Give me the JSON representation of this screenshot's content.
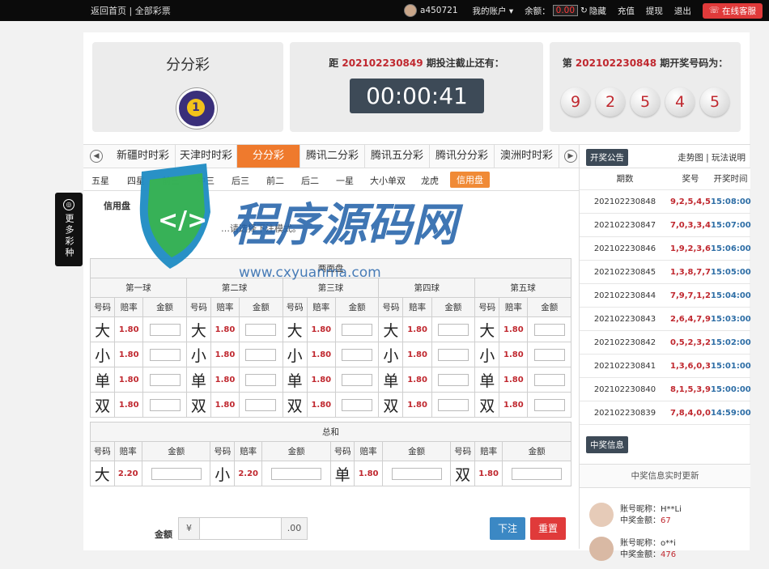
{
  "topbar": {
    "home_link": "返回首页",
    "all_lottery": "全部彩票",
    "username": "a450721",
    "my_account": "我的账户 ▾",
    "balance_label": "余额：",
    "balance_value": "0.00",
    "hide": "隐藏",
    "recharge": "充值",
    "withdraw": "提现",
    "logout": "退出",
    "customer_service": "在线客服"
  },
  "game": {
    "name": "分分彩",
    "logo_text": "1"
  },
  "countdown": {
    "prefix": "距",
    "period": "202102230849",
    "suffix": "期投注截止还有：",
    "time": "00:00:41"
  },
  "last_draw": {
    "prefix": "第",
    "period": "202102230848",
    "suffix": "期开奖号码为：",
    "balls": [
      "9",
      "2",
      "5",
      "4",
      "5"
    ]
  },
  "tabs": [
    "新疆时时彩",
    "天津时时彩",
    "分分彩",
    "腾讯二分彩",
    "腾讯五分彩",
    "腾讯分分彩",
    "澳洲时时彩"
  ],
  "subtabs": [
    "五星",
    "四星",
    "前三",
    "中三",
    "后三",
    "前二",
    "后二",
    "一星",
    "大小单双",
    "龙虎",
    "信用盘"
  ],
  "credit_label": "信用盘",
  "hint": "…请选择下注模式。",
  "balls_table": {
    "title": "两面盘",
    "groups": [
      "第一球",
      "第二球",
      "第三球",
      "第四球",
      "第五球"
    ],
    "col_headers": [
      "号码",
      "赔率",
      "金额"
    ],
    "rows": [
      {
        "label": "大",
        "odds": "1.80"
      },
      {
        "label": "小",
        "odds": "1.80"
      },
      {
        "label": "单",
        "odds": "1.80"
      },
      {
        "label": "双",
        "odds": "1.80"
      }
    ]
  },
  "sum_table": {
    "title": "总和",
    "col_headers": [
      "号码",
      "赔率",
      "金额"
    ],
    "items": [
      {
        "label": "大",
        "odds": "2.20"
      },
      {
        "label": "小",
        "odds": "2.20"
      },
      {
        "label": "单",
        "odds": "1.80"
      },
      {
        "label": "双",
        "odds": "1.80"
      }
    ]
  },
  "bet": {
    "amount_label": "金额",
    "currency": "¥",
    "decimal": ".00",
    "submit": "下注",
    "reset": "重置"
  },
  "right_panel": {
    "notice_btn": "开奖公告",
    "trend": "走势图",
    "rules": "玩法说明",
    "headers": [
      "期数",
      "奖号",
      "开奖时间"
    ],
    "results": [
      {
        "period": "202102230848",
        "nums": "9,2,5,4,5",
        "time": "15:08:00"
      },
      {
        "period": "202102230847",
        "nums": "7,0,3,3,4",
        "time": "15:07:00"
      },
      {
        "period": "202102230846",
        "nums": "1,9,2,3,6",
        "time": "15:06:00"
      },
      {
        "period": "202102230845",
        "nums": "1,3,8,7,7",
        "time": "15:05:00"
      },
      {
        "period": "202102230844",
        "nums": "7,9,7,1,2",
        "time": "15:04:00"
      },
      {
        "period": "202102230843",
        "nums": "2,6,4,7,9",
        "time": "15:03:00"
      },
      {
        "period": "202102230842",
        "nums": "0,5,2,3,2",
        "time": "15:02:00"
      },
      {
        "period": "202102230841",
        "nums": "1,3,6,0,3",
        "time": "15:01:00"
      },
      {
        "period": "202102230840",
        "nums": "8,1,5,3,9",
        "time": "15:00:00"
      },
      {
        "period": "202102230839",
        "nums": "7,8,4,0,0",
        "time": "14:59:00"
      }
    ],
    "win_btn": "中奖信息",
    "win_header": "中奖信息实时更新",
    "winners": [
      {
        "nick_label": "账号昵称：",
        "nick": "H**Li",
        "amt_label": "中奖金额：",
        "amt": "67"
      },
      {
        "nick_label": "账号昵称：",
        "nick": "o**i",
        "amt_label": "中奖金额：",
        "amt": "476"
      }
    ]
  },
  "side_float": {
    "text": "更多彩种"
  },
  "watermark": {
    "title": "程序源码网",
    "url": "www.cxyuanma.com"
  },
  "colors": {
    "accent": "#ef7a2d",
    "red": "#c0282f",
    "dark": "#3d4a57",
    "service": "#e03a3a",
    "blue": "#3b88c4"
  }
}
